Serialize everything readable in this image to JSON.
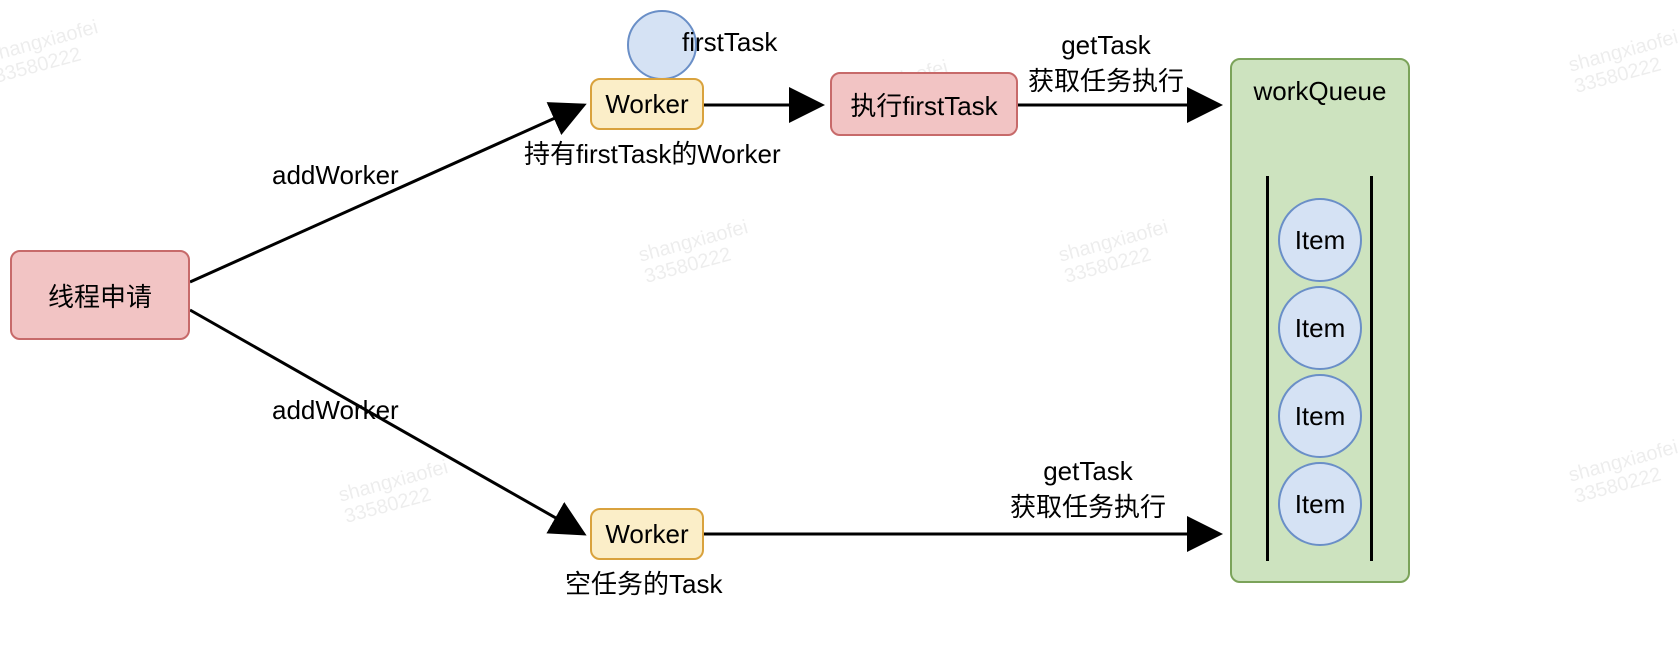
{
  "watermark": {
    "line1": "shangxiaofei",
    "line2": "33580222"
  },
  "nodes": {
    "threadRequest": "线程申请",
    "worker": "Worker",
    "executeFirstTask": "执行firstTask",
    "workQueue": "workQueue"
  },
  "labels": {
    "firstTask": "firstTask",
    "workerWithFirstTask": "持有firstTask的Worker",
    "emptyTaskWorker": "空任务的Task",
    "addWorker": "addWorker",
    "getTask": "getTask",
    "fetchExecute": "获取任务执行"
  },
  "queueItems": [
    "Item",
    "Item",
    "Item",
    "Item"
  ],
  "chart_data": {
    "type": "diagram",
    "title": "",
    "nodes": [
      {
        "id": "threadRequest",
        "label": "线程申请",
        "kind": "process",
        "color": "red"
      },
      {
        "id": "workerTop",
        "label": "Worker",
        "kind": "worker",
        "color": "yellow",
        "attached": "firstTask",
        "caption": "持有firstTask的Worker"
      },
      {
        "id": "execFirstTask",
        "label": "执行firstTask",
        "kind": "process",
        "color": "red"
      },
      {
        "id": "workerBottom",
        "label": "Worker",
        "kind": "worker",
        "color": "yellow",
        "caption": "空任务的Task"
      },
      {
        "id": "workQueue",
        "label": "workQueue",
        "kind": "queue",
        "color": "green",
        "items": [
          "Item",
          "Item",
          "Item",
          "Item"
        ]
      }
    ],
    "edges": [
      {
        "from": "threadRequest",
        "to": "workerTop",
        "label": "addWorker"
      },
      {
        "from": "threadRequest",
        "to": "workerBottom",
        "label": "addWorker"
      },
      {
        "from": "workerTop",
        "to": "execFirstTask",
        "label": ""
      },
      {
        "from": "execFirstTask",
        "to": "workQueue",
        "label": "getTask 获取任务执行"
      },
      {
        "from": "workerBottom",
        "to": "workQueue",
        "label": "getTask 获取任务执行"
      }
    ]
  }
}
